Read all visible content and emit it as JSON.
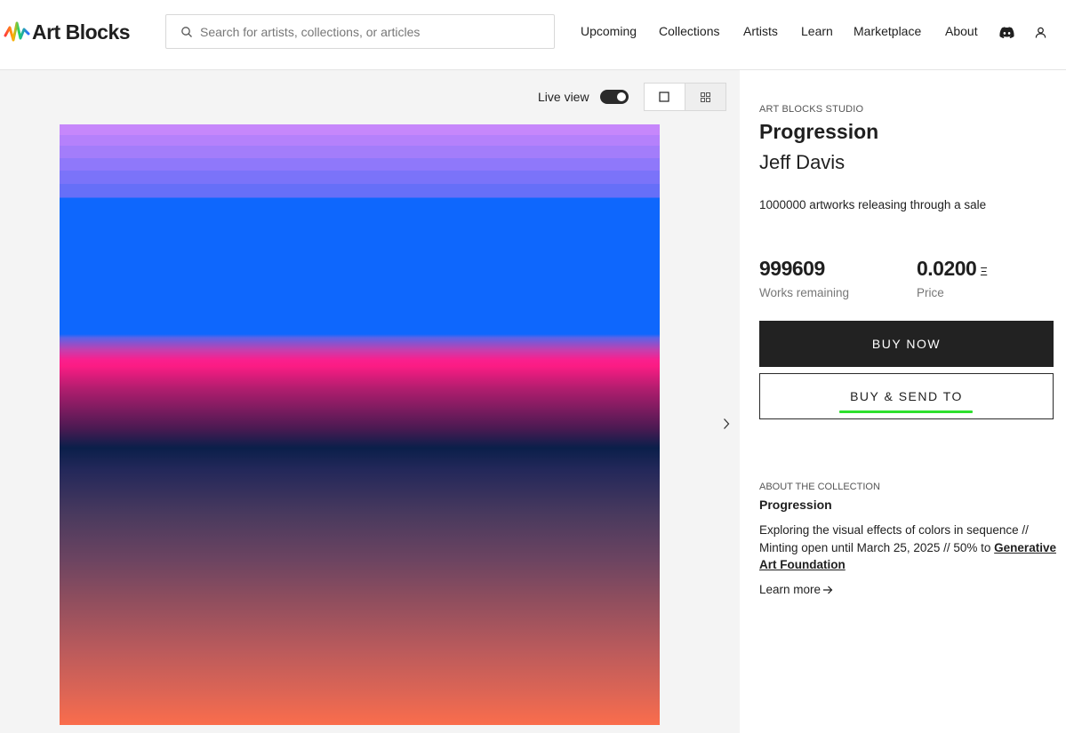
{
  "header": {
    "logo_text": "Art Blocks",
    "search_placeholder": "Search for artists, collections, or articles",
    "nav": [
      "Upcoming",
      "Collections",
      "Artists",
      "Learn",
      "Marketplace",
      "About"
    ],
    "icons": [
      "discord-icon",
      "user-icon"
    ]
  },
  "gallery": {
    "live_view_label": "Live view",
    "live_view_on": true,
    "view_options": [
      "single-view-icon",
      "grid-view-icon"
    ]
  },
  "project": {
    "studio": "ART BLOCKS STUDIO",
    "title": "Progression",
    "artist": "Jeff Davis",
    "release_text": "1000000 artworks releasing through a sale",
    "works_remaining": "999609",
    "works_remaining_label": "Works remaining",
    "price": "0.0200",
    "price_currency": "Ξ",
    "price_label": "Price",
    "buy_now_label": "BUY NOW",
    "buy_send_label": "BUY & SEND TO"
  },
  "about": {
    "label": "ABOUT THE COLLECTION",
    "title": "Progression",
    "description": "Exploring the visual effects of colors in sequence // Minting open until March 25, 2025 // 50% to ",
    "link_text": "Generative Art Foundation",
    "learn_more": "Learn more"
  }
}
